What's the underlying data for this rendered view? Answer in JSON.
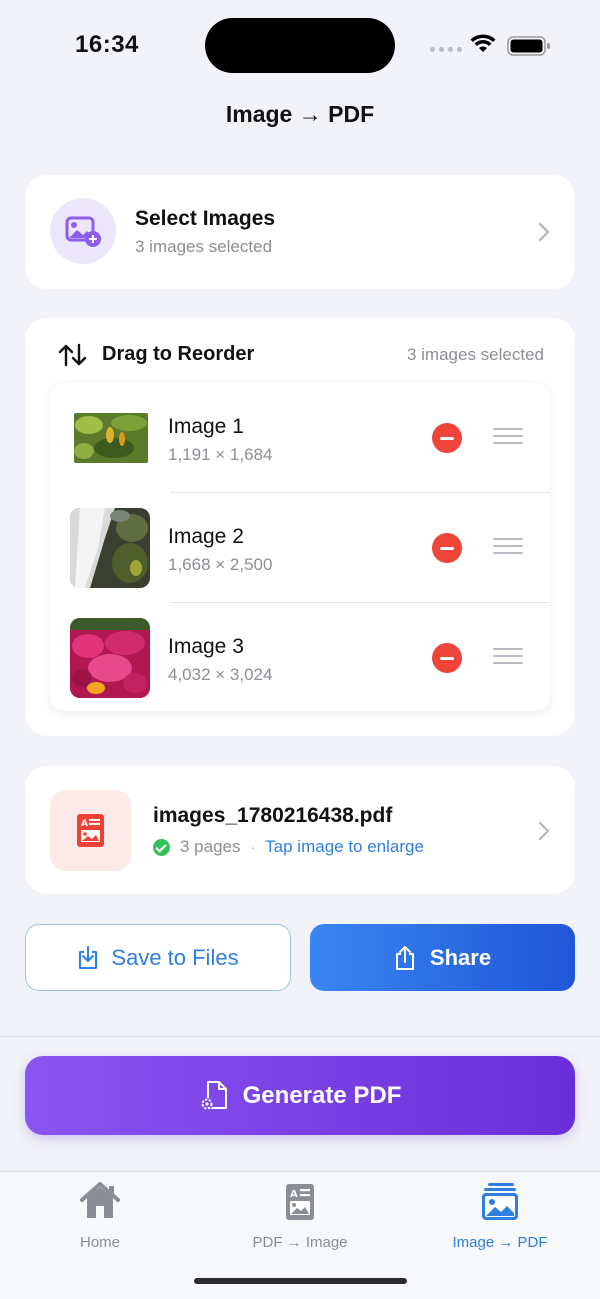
{
  "status": {
    "time": "16:34"
  },
  "nav": {
    "title": "Image → PDF"
  },
  "select_card": {
    "icon": "image-plus-icon",
    "title": "Select Images",
    "subtitle": "3 images selected"
  },
  "reorder": {
    "icon": "sort-arrows-icon",
    "title": "Drag to Reorder",
    "count": "3 images selected",
    "images": [
      {
        "name": "Image 1",
        "dimensions": "1,191 × 1,684"
      },
      {
        "name": "Image 2",
        "dimensions": "1,668 × 2,500"
      },
      {
        "name": "Image 3",
        "dimensions": "4,032 × 3,024"
      }
    ]
  },
  "pdf": {
    "icon": "pdf-file-icon",
    "filename": "images_1780216438.pdf",
    "pages": "3 pages",
    "separator": "·",
    "hint": "Tap image to enlarge"
  },
  "actions": {
    "save_label": "Save to Files",
    "share_label": "Share",
    "generate_label": "Generate PDF"
  },
  "tabs": [
    {
      "label": "Home",
      "icon": "house-icon",
      "active": false
    },
    {
      "label": "PDF → Image",
      "icon": "pdf-image-icon",
      "active": false
    },
    {
      "label": "Image → PDF",
      "icon": "photo-stack-icon",
      "active": true
    }
  ],
  "colors": {
    "accent_blue": "#2f7fe0",
    "accent_purple": "#7a40e6",
    "remove_red": "#f0443a",
    "success_green": "#34c159"
  }
}
